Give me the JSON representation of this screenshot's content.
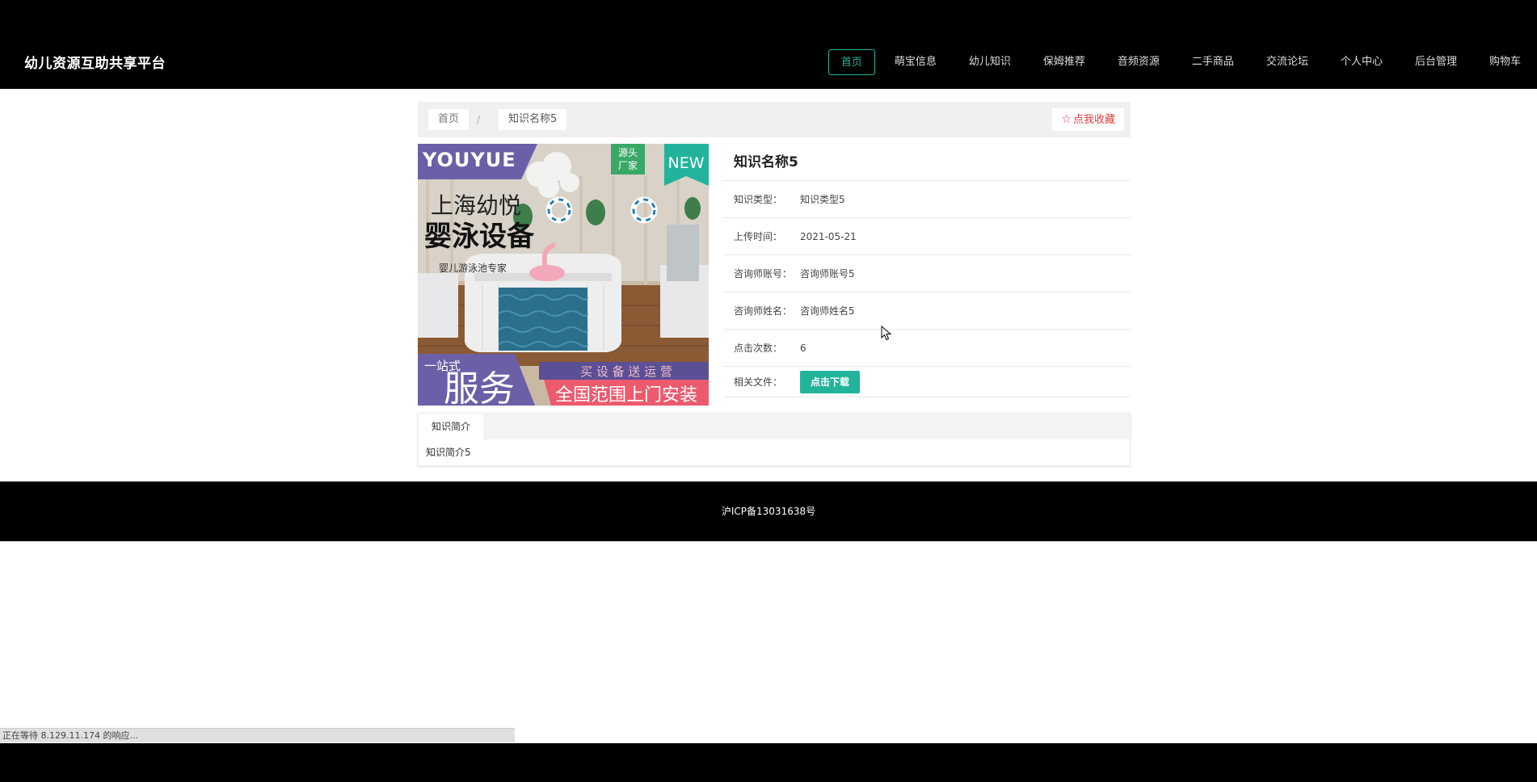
{
  "header": {
    "brand": "幼儿资源互助共享平台",
    "nav": [
      {
        "label": "首页",
        "active": true
      },
      {
        "label": "萌宝信息"
      },
      {
        "label": "幼儿知识"
      },
      {
        "label": "保姆推荐"
      },
      {
        "label": "音频资源"
      },
      {
        "label": "二手商品"
      },
      {
        "label": "交流论坛"
      },
      {
        "label": "个人中心"
      },
      {
        "label": "后台管理"
      },
      {
        "label": "购物车"
      }
    ]
  },
  "breadcrumb": {
    "home": "首页",
    "separator": "/",
    "current": "知识名称5"
  },
  "favorite_label": "点我收藏",
  "poster": {
    "brand_text": "YOUYUE",
    "badge_top": "源头",
    "badge_bottom": "厂家",
    "new_tag": "NEW",
    "line1": "上海幼悦",
    "line2": "婴泳设备",
    "line3": "婴儿游泳池专家",
    "service_small": "一站式",
    "service_big": "服务",
    "promo_top": "买 设 备 送 运 营",
    "promo_bottom": "全国范围上门安装"
  },
  "detail": {
    "title": "知识名称5",
    "rows": [
      {
        "label": "知识类型：",
        "value": "知识类型5"
      },
      {
        "label": "上传时间：",
        "value": "2021-05-21"
      },
      {
        "label": "咨询师账号：",
        "value": "咨询师账号5"
      },
      {
        "label": "咨询师姓名：",
        "value": "咨询师姓名5"
      },
      {
        "label": "点击次数：",
        "value": "6"
      }
    ],
    "file_label": "相关文件：",
    "download_label": "点击下载"
  },
  "tabs": {
    "tab_label": "知识简介",
    "content": "知识简介5"
  },
  "footer": {
    "icp": "沪ICP备13031638号"
  },
  "status": {
    "text": "正在等待 8.129.11.174 的响应..."
  },
  "colors": {
    "accent": "#22b49a",
    "favorite": "#e33b3b",
    "background_dark": "#000000"
  }
}
